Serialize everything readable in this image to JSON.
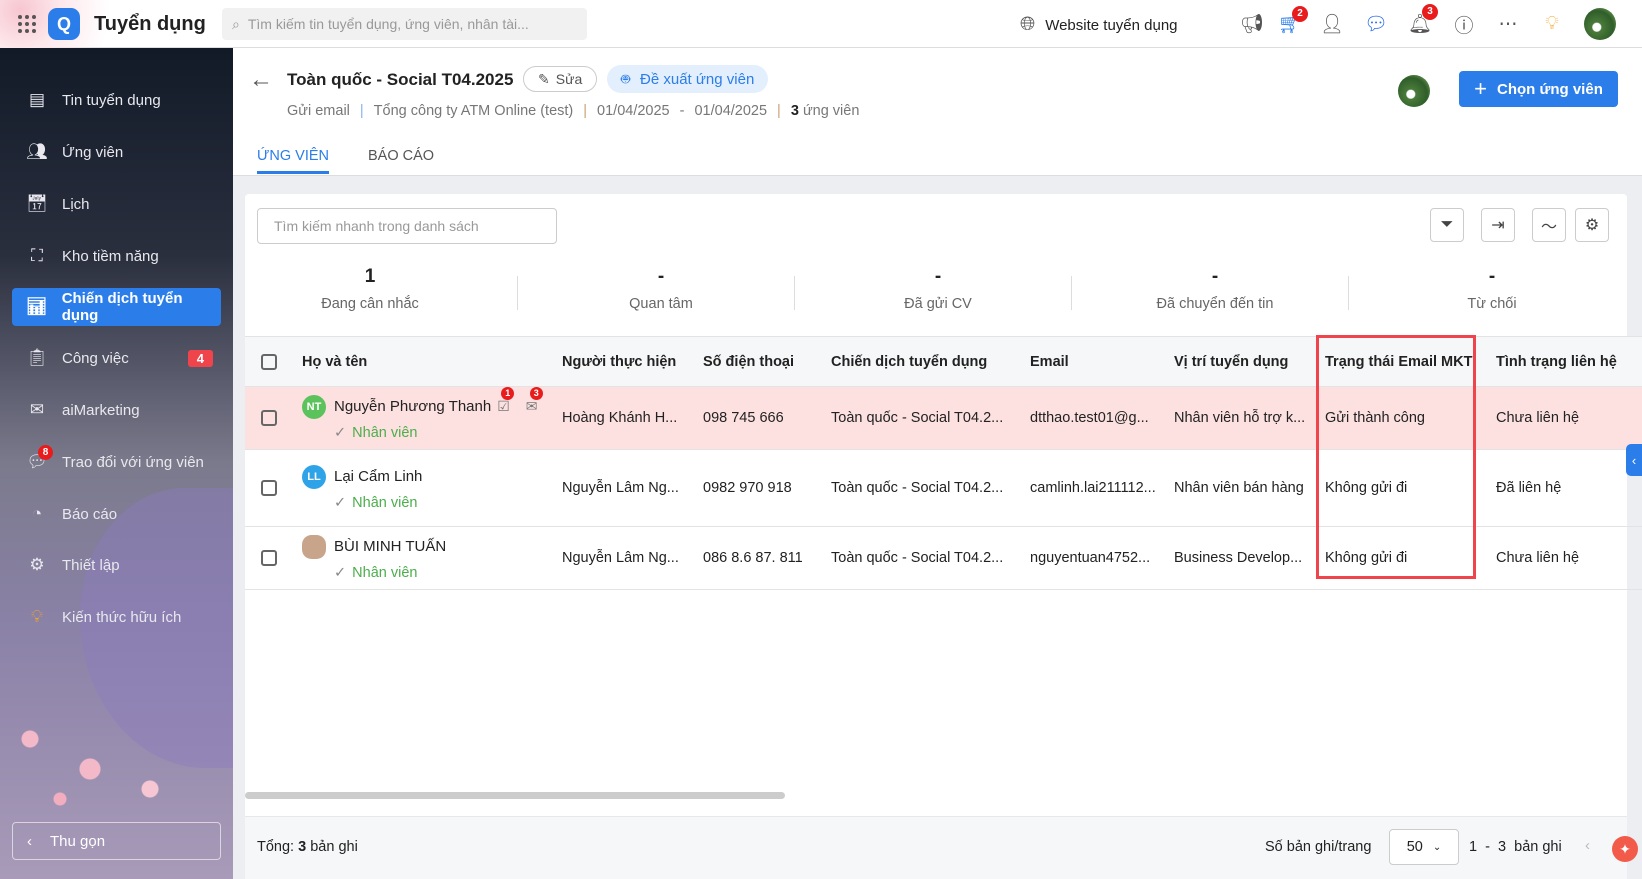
{
  "topbar": {
    "app_name": "Tuyển dụng",
    "logo": "Q",
    "search_placeholder": "Tìm kiếm tin tuyển dụng, ứng viên, nhân tài...",
    "website_label": "Website tuyển dụng",
    "cart_badge": "2",
    "notification_badge": "3"
  },
  "sidebar": {
    "items": [
      {
        "label": "Tin tuyển dụng",
        "icon": "news-icon"
      },
      {
        "label": "Ứng viên",
        "icon": "users-icon"
      },
      {
        "label": "Lịch",
        "icon": "calendar-icon"
      },
      {
        "label": "Kho tiềm năng",
        "icon": "talent-pool-icon"
      },
      {
        "label": "Chiến dịch tuyển dụng",
        "icon": "presentation-icon"
      },
      {
        "label": "Công việc",
        "icon": "clipboard-icon",
        "count": "4"
      },
      {
        "label": "aiMarketing",
        "icon": "mail-icon"
      },
      {
        "label": "Trao đổi với ứng viên",
        "icon": "chat-icon",
        "badge": "8"
      },
      {
        "label": "Báo cáo",
        "icon": "pie-chart-icon"
      },
      {
        "label": "Thiết lập",
        "icon": "gear-icon"
      },
      {
        "label": "Kiến thức hữu ích",
        "icon": "lightbulb-icon"
      }
    ],
    "collapse_label": "Thu gọn"
  },
  "header": {
    "title": "Toàn quốc - Social T04.2025",
    "edit_label": "Sửa",
    "suggest_label": "Đề xuất ứng viên",
    "meta": {
      "type": "Gửi email",
      "company": "Tổng công ty ATM Online (test)",
      "start": "01/04/2025",
      "dash": "-",
      "end": "01/04/2025",
      "count": "3",
      "count_label": "ứng viên"
    },
    "choose_label": "Chọn ứng viên",
    "tabs": [
      "ỨNG VIÊN",
      "BÁO CÁO"
    ]
  },
  "list": {
    "search_placeholder": "Tìm kiếm nhanh trong danh sách",
    "stats": [
      {
        "value": "1",
        "label": "Đang cân nhắc"
      },
      {
        "value": "-",
        "label": "Quan tâm"
      },
      {
        "value": "-",
        "label": "Đã gửi CV"
      },
      {
        "value": "-",
        "label": "Đã chuyển đến tin"
      },
      {
        "value": "-",
        "label": "Từ chối"
      }
    ],
    "columns": [
      "Họ và tên",
      "Người thực hiện",
      "Số điện thoại",
      "Chiến dịch tuyển dụng",
      "Email",
      "Vị trí tuyển dụng",
      "Trạng thái Email MKT",
      "Tình trạng liên hệ"
    ],
    "rows": [
      {
        "initials": "NT",
        "avatar_color": "#5cc25c",
        "name": "Nguyễn Phương Thanh",
        "task_badge": "1",
        "mail_badge": "3",
        "role": "Nhân viên",
        "owner": "Hoàng Khánh H...",
        "phone": "098 745 666",
        "campaign": "Toàn quốc - Social T04.2...",
        "email": "dtthao.test01@g...",
        "position": "Nhân viên hỗ trợ k...",
        "email_status": "Gửi thành công",
        "contact": "Chưa liên hệ"
      },
      {
        "initials": "LL",
        "avatar_color": "#2ea3e8",
        "name": "Lại Cẩm Linh",
        "role": "Nhân viên",
        "owner": "Nguyễn Lâm Ng...",
        "phone": "0982 970 918",
        "campaign": "Toàn quốc - Social T04.2...",
        "email": "camlinh.lai211112...",
        "position": "Nhân viên bán hàng",
        "email_status": "Không gửi đi",
        "contact": "Đã liên hệ"
      },
      {
        "initials": "",
        "avatar_color": "#c8a58a",
        "name": "BÙI MINH TUẤN",
        "role": "Nhân viên",
        "owner": "Nguyễn Lâm Ng...",
        "phone": "086 8.6 87. 811",
        "campaign": "Toàn quốc - Social T04.2...",
        "email": "nguyentuan4752...",
        "position": "Business Develop...",
        "email_status": "Không gửi đi",
        "contact": "Chưa liên hệ"
      }
    ],
    "footer": {
      "total_label": "Tổng:",
      "total": "3",
      "total_unit": "bản ghi",
      "per_page_label": "Số bản ghi/trang",
      "per_page": "50",
      "range": "1  -  3  bản ghi"
    }
  }
}
